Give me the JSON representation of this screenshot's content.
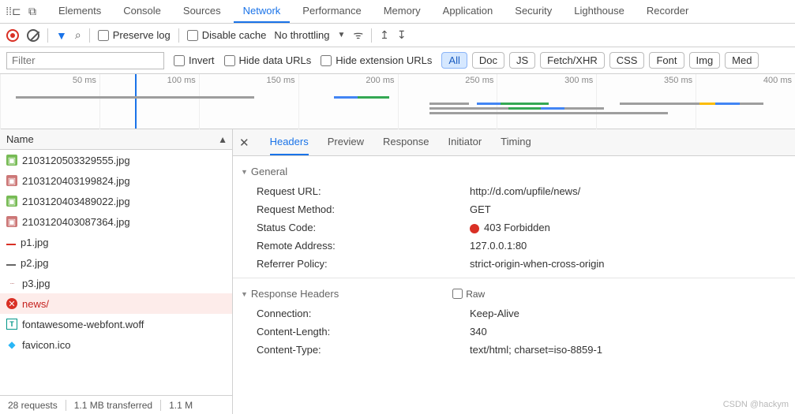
{
  "top_tabs": [
    "Elements",
    "Console",
    "Sources",
    "Network",
    "Performance",
    "Memory",
    "Application",
    "Security",
    "Lighthouse",
    "Recorder"
  ],
  "top_active": "Network",
  "toolbar": {
    "preserve": "Preserve log",
    "disable": "Disable cache",
    "throttle": "No throttling"
  },
  "filterbar": {
    "placeholder": "Filter",
    "invert": "Invert",
    "hide_data": "Hide data URLs",
    "hide_ext": "Hide extension URLs",
    "types": [
      "All",
      "Doc",
      "JS",
      "Fetch/XHR",
      "CSS",
      "Font",
      "Img",
      "Med"
    ],
    "type_sel": "All"
  },
  "timeline_ticks": [
    "50 ms",
    "100 ms",
    "150 ms",
    "200 ms",
    "250 ms",
    "300 ms",
    "350 ms",
    "400 ms"
  ],
  "name_col": "Name",
  "requests": [
    {
      "icon": "img",
      "name": "2103120503329555.jpg"
    },
    {
      "icon": "img2",
      "name": "2103120403199824.jpg"
    },
    {
      "icon": "img",
      "name": "2103120403489022.jpg"
    },
    {
      "icon": "img2",
      "name": "2103120403087364.jpg"
    },
    {
      "icon": "redline",
      "name": "p1.jpg"
    },
    {
      "icon": "grayline",
      "name": "p2.jpg"
    },
    {
      "icon": "dots",
      "name": "p3.jpg"
    },
    {
      "icon": "red",
      "name": "news/",
      "err": true
    },
    {
      "icon": "teal",
      "name": "fontawesome-webfont.woff"
    },
    {
      "icon": "blue",
      "name": "favicon.ico"
    }
  ],
  "status": {
    "reqs": "28 requests",
    "xfer": "1.1 MB transferred",
    "res": "1.1 M"
  },
  "detail_tabs": [
    "Headers",
    "Preview",
    "Response",
    "Initiator",
    "Timing"
  ],
  "detail_active": "Headers",
  "general": {
    "title": "General",
    "items": [
      {
        "k": "Request URL:",
        "v": "http://d.com/upfile/news/"
      },
      {
        "k": "Request Method:",
        "v": "GET"
      },
      {
        "k": "Status Code:",
        "v": "403 Forbidden",
        "status": true
      },
      {
        "k": "Remote Address:",
        "v": "127.0.0.1:80"
      },
      {
        "k": "Referrer Policy:",
        "v": "strict-origin-when-cross-origin"
      }
    ]
  },
  "resp_hdr": {
    "title": "Response Headers",
    "raw": "Raw",
    "items": [
      {
        "k": "Connection:",
        "v": "Keep-Alive"
      },
      {
        "k": "Content-Length:",
        "v": "340"
      },
      {
        "k": "Content-Type:",
        "v": "text/html; charset=iso-8859-1"
      }
    ]
  },
  "watermark": "CSDN @hackym"
}
